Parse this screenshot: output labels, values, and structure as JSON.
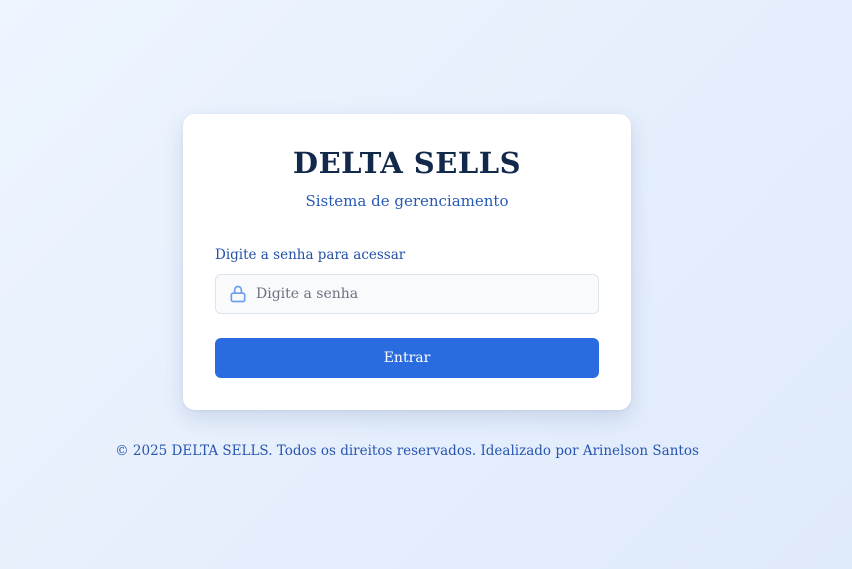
{
  "login": {
    "title": "DELTA SELLS",
    "subtitle": "Sistema de gerenciamento",
    "password_label": "Digite a senha para acessar",
    "password_placeholder": "Digite a senha",
    "password_icon": "lock-icon",
    "submit_label": "Entrar"
  },
  "footer": {
    "text": "© 2025 DELTA SELLS. Todos os direitos reservados. Idealizado por Arinelson Santos"
  },
  "colors": {
    "primary": "#2a6cdf",
    "title": "#13294b",
    "accent_text": "#2759b8"
  }
}
